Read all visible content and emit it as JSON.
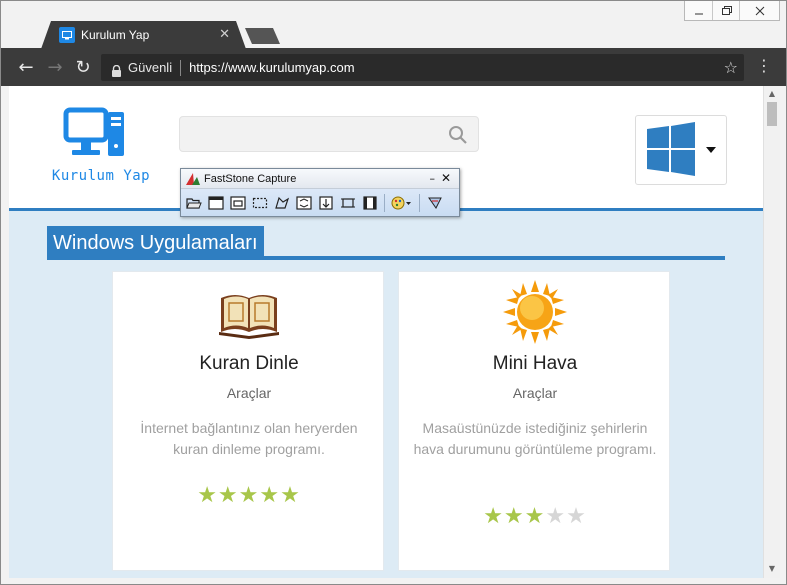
{
  "window": {
    "controls": {
      "minimize": "🗕",
      "restore": "🗗",
      "close": "✕"
    }
  },
  "tab": {
    "title": "Kurulum Yap",
    "close": "✕"
  },
  "toolbar": {
    "back": "←",
    "forward": "→",
    "reload": "↻",
    "secure_label": "Güvenli",
    "url": "https://www.kurulumyap.com",
    "bookmark": "☆",
    "menu": "⋮"
  },
  "site": {
    "logo_text": "Kurulum Yap",
    "search": {
      "placeholder": ""
    },
    "os_selector": {
      "icon": "windows-logo",
      "caret": "▼"
    }
  },
  "section": {
    "title": "Windows Uygulamaları"
  },
  "cards": [
    {
      "title": "Kuran Dinle",
      "category": "Araçlar",
      "description": "İnternet bağlantınız olan heryerden kuran dinleme programı.",
      "icon": "quran-book-icon",
      "rating": 5,
      "rating_max": 5,
      "stars_on": "★★★★★",
      "stars_off": ""
    },
    {
      "title": "Mini Hava",
      "category": "Araçlar",
      "description": "Masaüstünüzde istediğiniz şehirlerin hava durumunu görüntüleme programı.",
      "icon": "sun-icon",
      "rating": 3,
      "rating_max": 5,
      "stars_on": "★★★",
      "stars_off": "★★"
    }
  ],
  "faststone": {
    "title": "FastStone Capture",
    "minimize": "–",
    "close": "✕",
    "tools": [
      "open-file-icon",
      "capture-window-icon",
      "capture-object-icon",
      "capture-rectangle-icon",
      "capture-freehand-icon",
      "capture-fullscreen-icon",
      "capture-scrolling-icon",
      "capture-fixed-region-icon",
      "screen-recorder-icon",
      "output-options-icon",
      "settings-icon"
    ]
  },
  "colors": {
    "accent": "#2f7ec1",
    "logo_blue": "#1e88e5",
    "content_bg": "#ddebf5",
    "star_on": "#a8c64a",
    "star_off": "#d6d6d6",
    "chrome_dark": "#3b3b3b"
  }
}
